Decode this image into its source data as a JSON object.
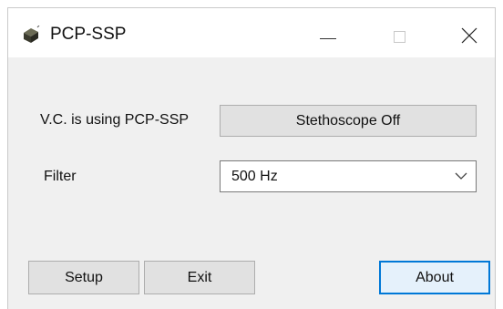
{
  "window": {
    "title": "PCP-SSP",
    "icon": "app-icon",
    "controls": {
      "minimize": "minimize-icon",
      "maximize": "maximize-icon",
      "close": "close-icon"
    }
  },
  "main": {
    "status_label": "V.C. is using PCP-SSP",
    "stethoscope_button": "Stethoscope Off",
    "filter_label": "Filter",
    "filter_selected": "500 Hz"
  },
  "footer": {
    "setup_button": "Setup",
    "exit_button": "Exit",
    "about_button": "About"
  },
  "colors": {
    "focus_border": "#0078d7",
    "button_face": "#e1e1e1",
    "window_background": "#f0f0f0"
  }
}
